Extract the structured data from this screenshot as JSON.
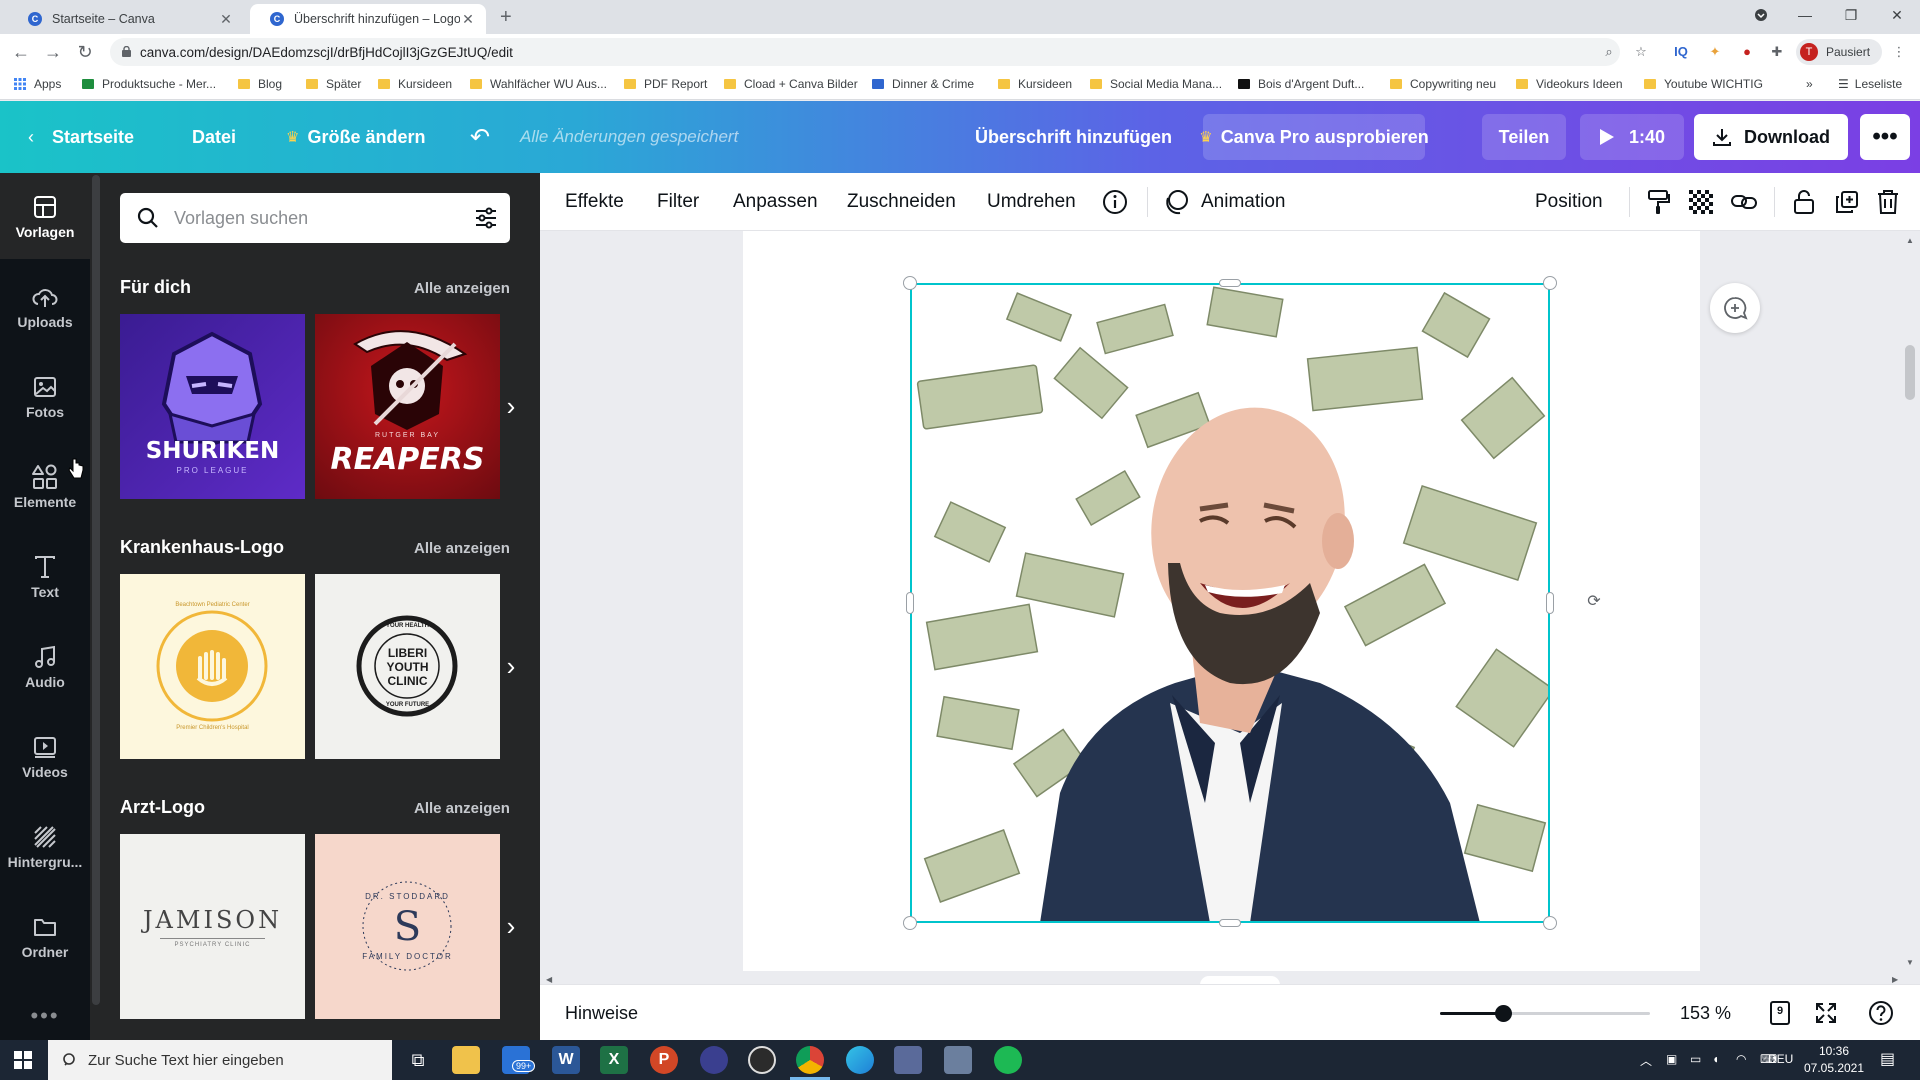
{
  "browser": {
    "tabs": [
      {
        "title": "Startseite – Canva",
        "active": false
      },
      {
        "title": "Überschrift hinzufügen – Logo",
        "active": true
      }
    ],
    "url": "canva.com/design/DAEdomzscjI/drBfjHdCojlI3jGzGEJtUQ/edit",
    "profile_status": "Pausiert",
    "profile_initial": "T",
    "bookmarks": [
      "Apps",
      "Produktsuche - Mer...",
      "Blog",
      "Später",
      "Kursideen",
      "Wahlfächer WU Aus...",
      "PDF Report",
      "Cload + Canva Bilder",
      "Dinner & Crime",
      "Kursideen",
      "Social Media Mana...",
      "Bois d'Argent Duft...",
      "Copywriting neu",
      "Videokurs Ideen",
      "Youtube WICHTIG"
    ],
    "reading_list": "Leseliste"
  },
  "topbar": {
    "home": "Startseite",
    "file": "Datei",
    "resize": "Größe ändern",
    "status": "Alle Änderungen gespeichert",
    "design_title": "Überschrift hinzufügen",
    "pro": "Canva Pro ausprobieren",
    "share": "Teilen",
    "play_time": "1:40",
    "download": "Download",
    "more": "•••"
  },
  "rail": [
    {
      "label": "Vorlagen",
      "icon": "templates-icon",
      "active": true
    },
    {
      "label": "Uploads",
      "icon": "upload-icon",
      "active": false
    },
    {
      "label": "Fotos",
      "icon": "photos-icon",
      "active": false
    },
    {
      "label": "Elemente",
      "icon": "elements-icon",
      "active": false
    },
    {
      "label": "Text",
      "icon": "text-icon",
      "active": false
    },
    {
      "label": "Audio",
      "icon": "audio-icon",
      "active": false
    },
    {
      "label": "Videos",
      "icon": "videos-icon",
      "active": false
    },
    {
      "label": "Hintergru...",
      "icon": "background-icon",
      "active": false
    },
    {
      "label": "Ordner",
      "icon": "folder-icon",
      "active": false
    }
  ],
  "panel": {
    "search_placeholder": "Vorlagen suchen",
    "sections": [
      {
        "title": "Für dich",
        "see_all": "Alle anzeigen",
        "thumbs": [
          {
            "line1": "SHURIKEN",
            "line2": "PRO LEAGUE"
          },
          {
            "line1": "REAPERS",
            "line2": "RUTGER BAY"
          }
        ]
      },
      {
        "title": "Krankenhaus-Logo",
        "see_all": "Alle anzeigen",
        "thumbs": [
          {
            "line1": "Beachtown Pediatric Center",
            "line2": "Premier Children's Hospital"
          },
          {
            "line1": "LIBERI",
            "line2": "YOUTH",
            "line3": "CLINIC",
            "ring_top": "YOUR HEALTH",
            "ring_bottom": "YOUR FUTURE"
          }
        ]
      },
      {
        "title": "Arzt-Logo",
        "see_all": "Alle anzeigen",
        "thumbs": [
          {
            "line1": "JAMISON",
            "line2": "PSYCHIATRY CLINIC"
          },
          {
            "line1": "S",
            "ring_top": "DR. STODDARD",
            "ring_bottom": "FAMILY DOCTOR"
          }
        ]
      }
    ]
  },
  "context_toolbar": {
    "effects": "Effekte",
    "filter": "Filter",
    "adjust": "Anpassen",
    "crop": "Zuschneiden",
    "flip": "Umdrehen",
    "animate": "Animation",
    "position": "Position"
  },
  "footer": {
    "notes": "Hinweise",
    "zoom": "153 %",
    "zoom_fraction": 0.3,
    "pages": "9"
  },
  "taskbar": {
    "search_placeholder": "Zur Suche Text hier eingeben",
    "mail_badge": "99+",
    "language": "DEU",
    "time": "10:36",
    "date": "07.05.2021"
  },
  "colors": {
    "canva_teal": "#00c4cc",
    "canva_purple": "#7b3fe4",
    "rail_bg": "#0e1318",
    "panel_bg": "#252627"
  }
}
